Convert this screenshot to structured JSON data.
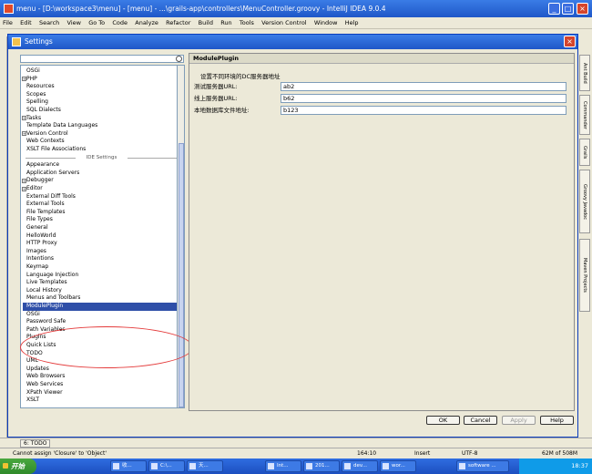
{
  "ide": {
    "title": "menu - [D:\\workspace3\\menu] - [menu] - ...\\grails-app\\controllers\\MenuController.groovy - IntelliJ IDEA 9.0.4",
    "menu": [
      "File",
      "Edit",
      "Search",
      "View",
      "Go To",
      "Code",
      "Analyze",
      "Refactor",
      "Build",
      "Run",
      "Tools",
      "Version Control",
      "Window",
      "Help"
    ],
    "right_tabs": [
      "Ant Build",
      "Commander",
      "Grails",
      "Groovy Javadoc",
      "Maven Projects"
    ],
    "bottom_tab": "6: TODO",
    "status_message": "Cannot assign 'Closure' to 'Object'",
    "cursor_pos": "164:10",
    "insert_mode": "Insert",
    "encoding": "UTF-8",
    "memory": "62M of 508M"
  },
  "dialog": {
    "title": "Settings",
    "tree": {
      "project_items": [
        {
          "label": "OSGi",
          "expandable": false
        },
        {
          "label": "PHP",
          "expandable": true
        },
        {
          "label": "Resources",
          "expandable": false
        },
        {
          "label": "Scopes",
          "expandable": false
        },
        {
          "label": "Spelling",
          "expandable": false
        },
        {
          "label": "SQL Dialects",
          "expandable": false
        },
        {
          "label": "Tasks",
          "expandable": true
        },
        {
          "label": "Template Data Languages",
          "expandable": false
        },
        {
          "label": "Version Control",
          "expandable": true
        },
        {
          "label": "Web Contexts",
          "expandable": false
        },
        {
          "label": "XSLT File Associations",
          "expandable": false
        }
      ],
      "ide_group_label": "IDE Settings",
      "ide_items": [
        {
          "label": "Appearance",
          "expandable": false
        },
        {
          "label": "Application Servers",
          "expandable": false
        },
        {
          "label": "Debugger",
          "expandable": true
        },
        {
          "label": "Editor",
          "expandable": true
        },
        {
          "label": "External Diff Tools",
          "expandable": false
        },
        {
          "label": "External Tools",
          "expandable": false
        },
        {
          "label": "File Templates",
          "expandable": false
        },
        {
          "label": "File Types",
          "expandable": false
        },
        {
          "label": "General",
          "expandable": false
        },
        {
          "label": "HelloWorld",
          "expandable": false
        },
        {
          "label": "HTTP Proxy",
          "expandable": false
        },
        {
          "label": "Images",
          "expandable": false
        },
        {
          "label": "Intentions",
          "expandable": false
        },
        {
          "label": "Keymap",
          "expandable": false
        },
        {
          "label": "Language Injection",
          "expandable": false
        },
        {
          "label": "Live Templates",
          "expandable": false
        },
        {
          "label": "Local History",
          "expandable": false
        },
        {
          "label": "Menus and Toolbars",
          "expandable": false
        },
        {
          "label": "ModulePlugin",
          "expandable": false,
          "selected": true
        },
        {
          "label": "OSGi",
          "expandable": false
        },
        {
          "label": "Password Safe",
          "expandable": false
        },
        {
          "label": "Path Variables",
          "expandable": false
        },
        {
          "label": "Plugins",
          "expandable": false
        },
        {
          "label": "Quick Lists",
          "expandable": false
        },
        {
          "label": "TODO",
          "expandable": false
        },
        {
          "label": "UML",
          "expandable": false
        },
        {
          "label": "Updates",
          "expandable": false
        },
        {
          "label": "Web Browsers",
          "expandable": false
        },
        {
          "label": "Web Services",
          "expandable": false
        },
        {
          "label": "XPath Viewer",
          "expandable": false
        },
        {
          "label": "XSLT",
          "expandable": false
        }
      ]
    },
    "panel": {
      "header": "ModulePlugin",
      "description": "设置不同环境的DC服务器地址",
      "fields": [
        {
          "label": "测试服务器URL:",
          "value": "ab2"
        },
        {
          "label": "线上服务器URL:",
          "value": "b62"
        },
        {
          "label": "本地数据库文件地址:",
          "value": "b123"
        }
      ]
    },
    "buttons": {
      "ok": "OK",
      "cancel": "Cancel",
      "apply": "Apply",
      "help": "Help"
    }
  },
  "taskbar": {
    "start": "开始",
    "tasks": [
      "收...",
      "C:\\...",
      "天...",
      "Int...",
      "201...",
      "dev...",
      "wor...",
      "software ..."
    ],
    "clock": "18:37"
  }
}
